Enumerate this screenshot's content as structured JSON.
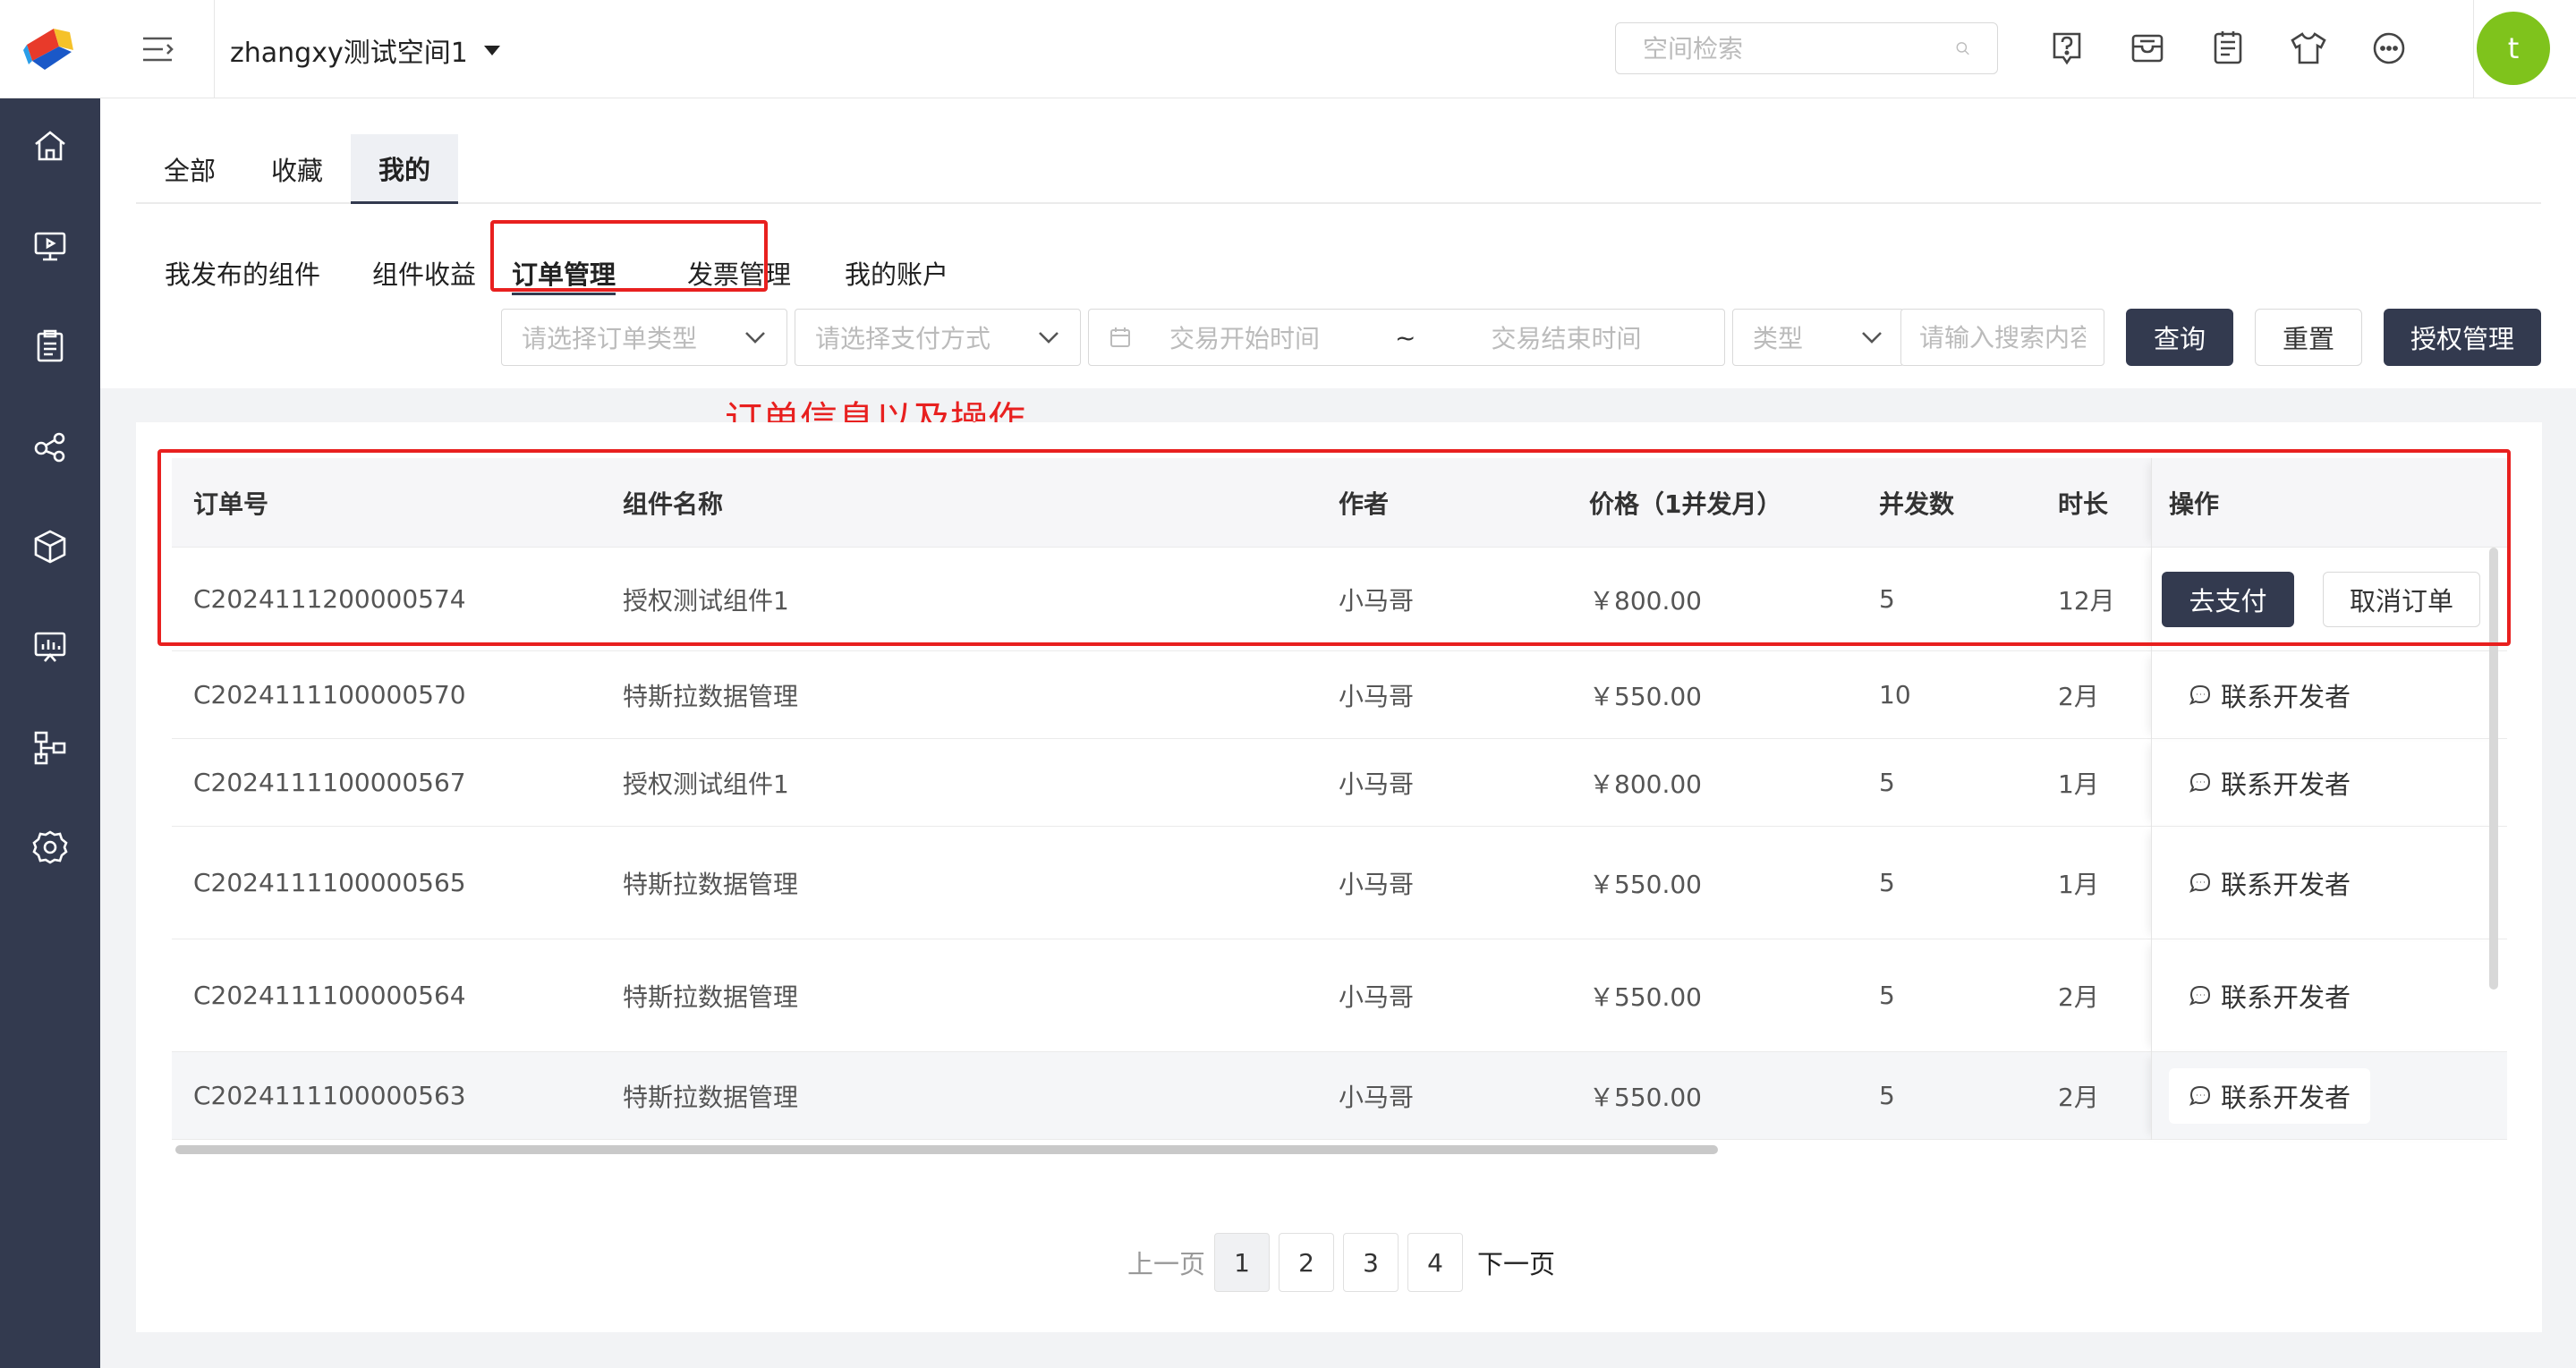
{
  "header": {
    "workspace": "zhangxy测试空间1",
    "search_placeholder": "空间检索",
    "avatar_letter": "t"
  },
  "tabs": {
    "main": [
      "全部",
      "收藏",
      "我的"
    ],
    "sub": [
      "我发布的组件",
      "组件收益",
      "订单管理",
      "发票管理",
      "我的账户"
    ]
  },
  "filters": {
    "order_type_placeholder": "请选择订单类型",
    "pay_method_placeholder": "请选择支付方式",
    "start_time_placeholder": "交易开始时间",
    "range_sep": "~",
    "end_time_placeholder": "交易结束时间",
    "type_placeholder": "类型",
    "keyword_placeholder": "请输入搜索内容",
    "query_label": "查询",
    "reset_label": "重置",
    "auth_label": "授权管理"
  },
  "annotation": "订单信息以及操作",
  "table": {
    "columns": [
      "订单号",
      "组件名称",
      "作者",
      "价格（1并发月）",
      "并发数",
      "时长",
      "操作"
    ],
    "rows": [
      {
        "order": "C2024111200000574",
        "component": "授权测试组件1",
        "author": "小马哥",
        "price": "￥800.00",
        "concurrency": "5",
        "duration": "12月"
      },
      {
        "order": "C2024111100000570",
        "component": "特斯拉数据管理",
        "author": "小马哥",
        "price": "￥550.00",
        "concurrency": "10",
        "duration": "2月"
      },
      {
        "order": "C2024111100000567",
        "component": "授权测试组件1",
        "author": "小马哥",
        "price": "￥800.00",
        "concurrency": "5",
        "duration": "1月"
      },
      {
        "order": "C2024111100000565",
        "component": "特斯拉数据管理",
        "author": "小马哥",
        "price": "￥550.00",
        "concurrency": "5",
        "duration": "1月"
      },
      {
        "order": "C2024111100000564",
        "component": "特斯拉数据管理",
        "author": "小马哥",
        "price": "￥550.00",
        "concurrency": "5",
        "duration": "2月"
      },
      {
        "order": "C2024111100000563",
        "component": "特斯拉数据管理",
        "author": "小马哥",
        "price": "￥550.00",
        "concurrency": "5",
        "duration": "2月"
      }
    ],
    "pay_label": "去支付",
    "cancel_label": "取消订单",
    "contact_label": "联系开发者"
  },
  "pagination": {
    "prev": "上一页",
    "pages": [
      "1",
      "2",
      "3",
      "4"
    ],
    "next": "下一页"
  },
  "colors": {
    "sidebar": "#333a4f",
    "primary_button": "#333a4f",
    "avatar": "#7fc31c",
    "annotation": "#e8201f"
  }
}
